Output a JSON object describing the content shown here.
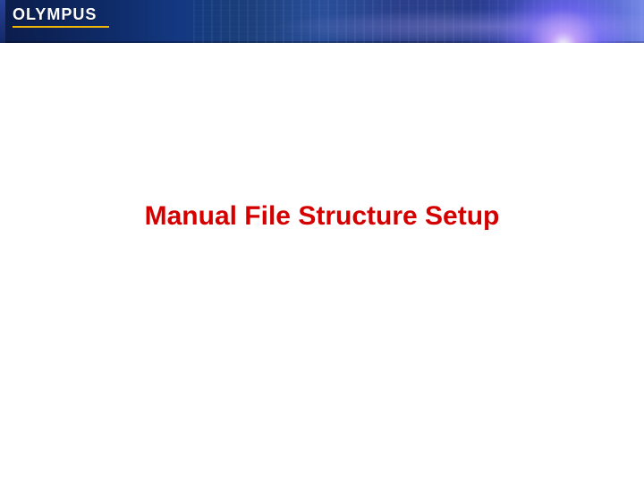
{
  "brand": {
    "logo_text": "OLYMPUS",
    "accent_color": "#f2b705"
  },
  "slide": {
    "title": "Manual File Structure Setup"
  },
  "colors": {
    "banner_primary": "#143982",
    "title_color": "#d40000"
  }
}
